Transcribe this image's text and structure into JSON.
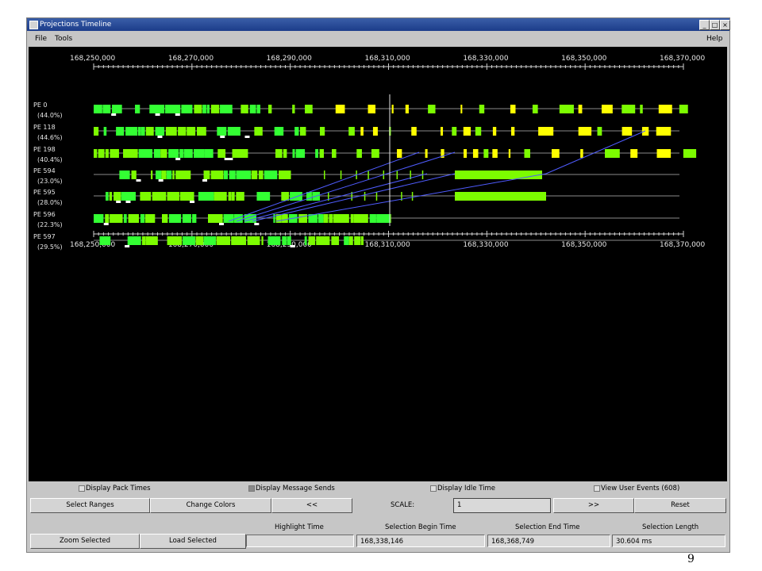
{
  "window": {
    "title": "Projections Timeline"
  },
  "menu": {
    "file": "File",
    "tools": "Tools",
    "help": "Help"
  },
  "axis": {
    "ticks": [
      "168,250,000",
      "168,270,000",
      "168,290,000",
      "168,310,000",
      "168,330,000",
      "168,350,000",
      "168,370,000"
    ]
  },
  "processors": [
    {
      "name": "PE 0",
      "util": "(44.0%)"
    },
    {
      "name": "PE 118",
      "util": "(44.6%)"
    },
    {
      "name": "PE 198",
      "util": "(40.4%)"
    },
    {
      "name": "PE 594",
      "util": "(23.0%)"
    },
    {
      "name": "PE 595",
      "util": "(28.0%)"
    },
    {
      "name": "PE 596",
      "util": "(22.3%)"
    },
    {
      "name": "PE 597",
      "util": "(29.5%)"
    }
  ],
  "options": {
    "pack_times": "Display Pack Times",
    "message_sends": "Display Message Sends",
    "idle_time": "Display Idle Time",
    "user_events": "View User Events (608)"
  },
  "buttons": {
    "select_ranges": "Select Ranges",
    "change_colors": "Change Colors",
    "prev": "<<",
    "next": ">>",
    "reset": "Reset",
    "zoom_selected": "Zoom Selected",
    "load_selected": "Load Selected"
  },
  "scale": {
    "label": "SCALE:",
    "value": "1"
  },
  "info": {
    "highlight_time_label": "Highlight Time",
    "highlight_time": "",
    "selection_begin_label": "Selection Begin Time",
    "selection_begin": "168,338,146",
    "selection_end_label": "Selection End Time",
    "selection_end": "168,368,749",
    "selection_length_label": "Selection Length",
    "selection_length": "30.604 ms"
  },
  "page_number": "9",
  "colors": {
    "busy": "#7cfc00",
    "busy_bright": "#33ff33",
    "user_event": "#ffff00",
    "message": "#4f5cff",
    "axis": "#d0d0d0"
  }
}
